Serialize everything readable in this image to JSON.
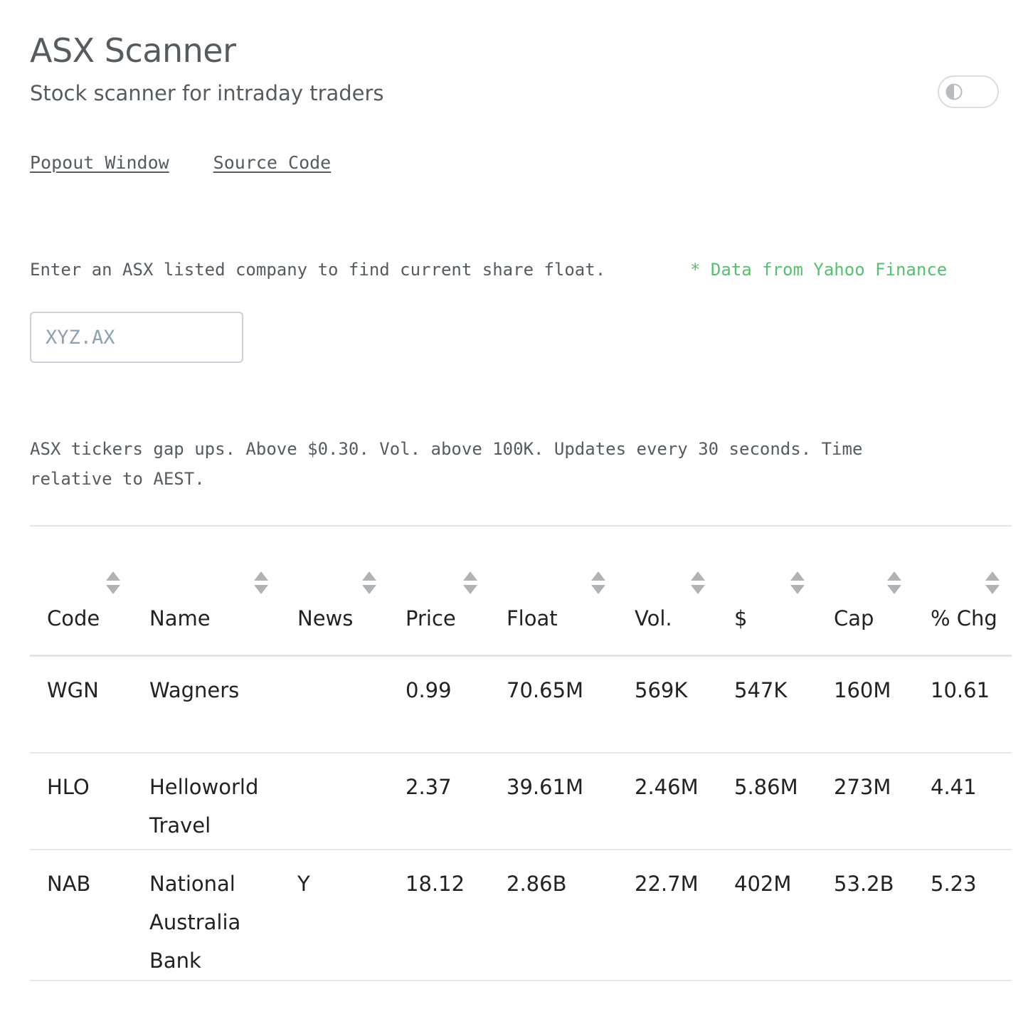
{
  "header": {
    "title": "ASX Scanner",
    "subtitle": "Stock scanner for intraday traders"
  },
  "theme_toggle": {
    "icon": "half-circle-contrast-icon",
    "state": "off"
  },
  "links": {
    "popout": "Popout Window",
    "source": "Source Code"
  },
  "float_lookup": {
    "prompt": "Enter an ASX listed company to find current share float.",
    "source_note": "* Data from Yahoo Finance",
    "placeholder": "XYZ.AX",
    "value": ""
  },
  "scanner": {
    "description": "ASX tickers gap ups. Above $0.30. Vol. above 100K. Updates every 30 seconds. Time relative to AEST.",
    "columns": [
      {
        "key": "code",
        "label": "Code"
      },
      {
        "key": "name",
        "label": "Name"
      },
      {
        "key": "news",
        "label": "News"
      },
      {
        "key": "price",
        "label": "Price"
      },
      {
        "key": "float",
        "label": "Float"
      },
      {
        "key": "vol",
        "label": "Vol."
      },
      {
        "key": "dollar",
        "label": "$"
      },
      {
        "key": "cap",
        "label": "Cap"
      },
      {
        "key": "chg",
        "label": "% Chg"
      }
    ],
    "rows": [
      {
        "code": "WGN",
        "name": "Wagners",
        "news": "",
        "price": "0.99",
        "float": "70.65M",
        "vol": "569K",
        "dollar": "547K",
        "cap": "160M",
        "chg": "10.61"
      },
      {
        "code": "HLO",
        "name": "Helloworld Travel",
        "news": "",
        "price": "2.37",
        "float": "39.61M",
        "vol": "2.46M",
        "dollar": "5.86M",
        "cap": "273M",
        "chg": "4.41"
      },
      {
        "code": "NAB",
        "name": "National Australia Bank",
        "news": "Y",
        "price": "18.12",
        "float": "2.86B",
        "vol": "22.7M",
        "dollar": "402M",
        "cap": "53.2B",
        "chg": "5.23"
      }
    ]
  },
  "colors": {
    "text_muted": "#555c61",
    "accent_green": "#55c06d",
    "border": "#e2e6ea",
    "sort_arrow": "#b0b3b6"
  }
}
